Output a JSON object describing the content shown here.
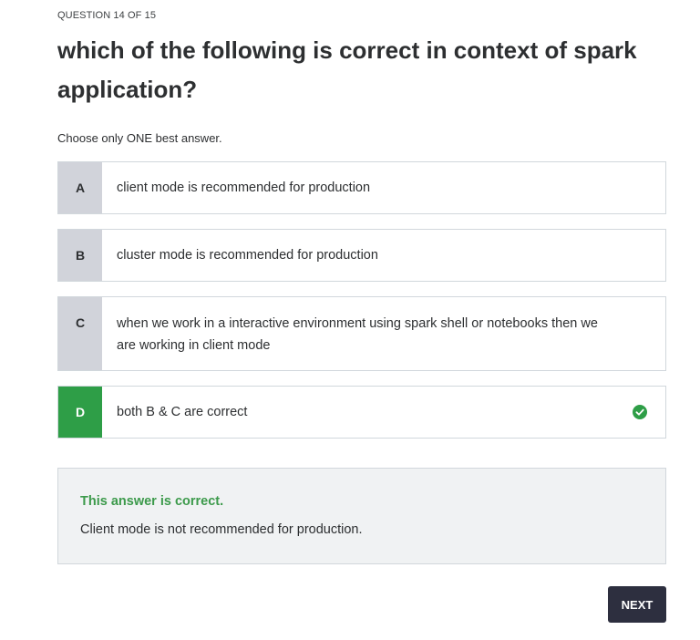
{
  "quiz": {
    "counter": "QUESTION 14 OF 15",
    "question": "which of the following is correct in context of spark application?",
    "instruction": "Choose only ONE best answer."
  },
  "options": [
    {
      "letter": "A",
      "text": "client mode is recommended for production",
      "selected": false
    },
    {
      "letter": "B",
      "text": "cluster mode is recommended for production",
      "selected": false
    },
    {
      "letter": "C",
      "text": "when we work in a interactive environment using spark shell or notebooks then we are working in client mode",
      "selected": false
    },
    {
      "letter": "D",
      "text": "both B & C are correct",
      "selected": true,
      "status_icon": "check-circle-icon"
    }
  ],
  "feedback": {
    "title": "This answer is correct.",
    "explanation": "Client mode is not recommended for production."
  },
  "actions": {
    "next_label": "NEXT"
  },
  "colors": {
    "correct": "#2e9e47",
    "letter_bg": "#d1d3da",
    "button_bg": "#2d2f3f"
  }
}
